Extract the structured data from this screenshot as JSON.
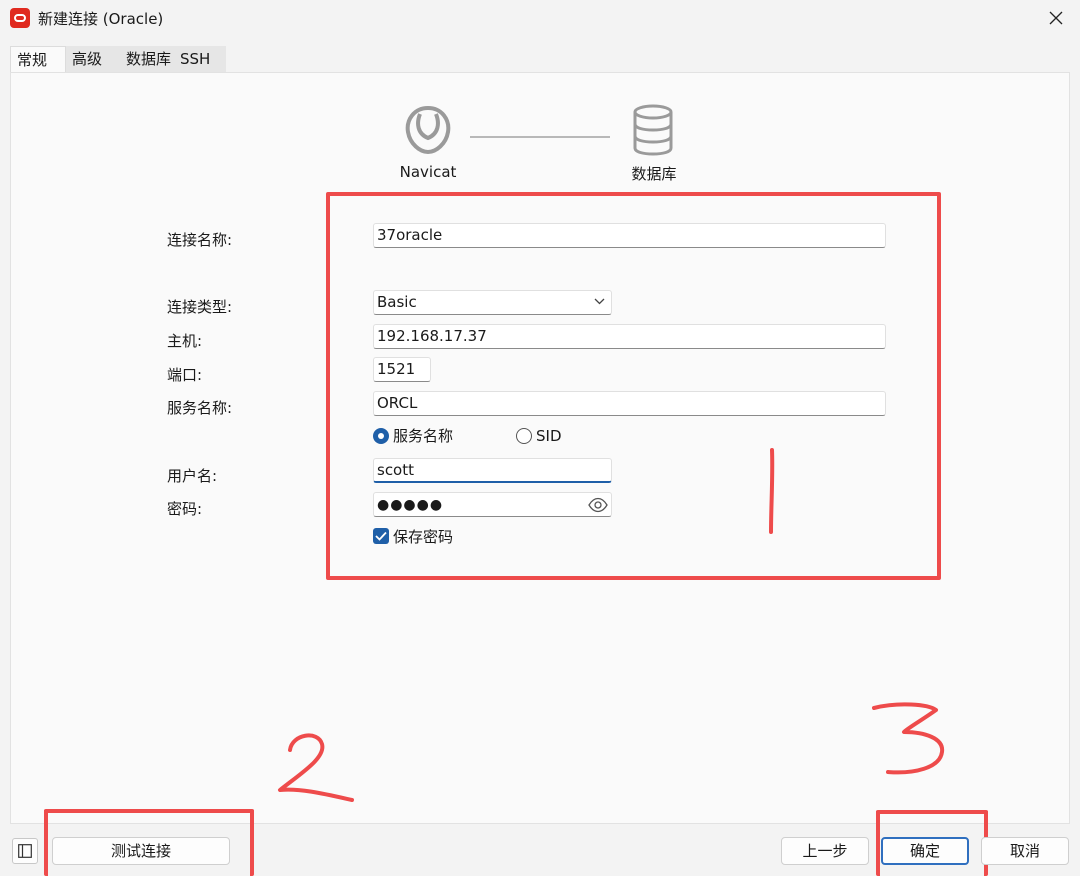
{
  "window": {
    "title": "新建连接 (Oracle)"
  },
  "tabs": [
    {
      "label": "常规",
      "active": true
    },
    {
      "label": "高级",
      "active": false
    },
    {
      "label": "数据库",
      "active": false
    },
    {
      "label": "SSH",
      "active": false
    }
  ],
  "flow": {
    "source_label": "Navicat",
    "target_label": "数据库"
  },
  "form": {
    "connection_name": {
      "label": "连接名称:",
      "value": "37oracle"
    },
    "connection_type": {
      "label": "连接类型:",
      "value": "Basic"
    },
    "host": {
      "label": "主机:",
      "value": "192.168.17.37"
    },
    "port": {
      "label": "端口:",
      "value": "1521"
    },
    "service_name": {
      "label": "服务名称:",
      "value": "ORCL"
    },
    "service_mode": {
      "option_service": "服务名称",
      "option_sid": "SID",
      "selected": "服务名称"
    },
    "username": {
      "label": "用户名:",
      "value": "scott"
    },
    "password": {
      "label": "密码:",
      "value": "●●●●●"
    },
    "save_password": {
      "label": "保存密码",
      "checked": true
    }
  },
  "annotations": {
    "box1": "1",
    "box2": "2",
    "box3": "3",
    "color": "#ee4b4b"
  },
  "footer": {
    "test_connection": "测试连接",
    "previous": "上一步",
    "ok": "确定",
    "cancel": "取消"
  },
  "colors": {
    "accent": "#1f5fa8",
    "brand": "#e02a1f"
  }
}
